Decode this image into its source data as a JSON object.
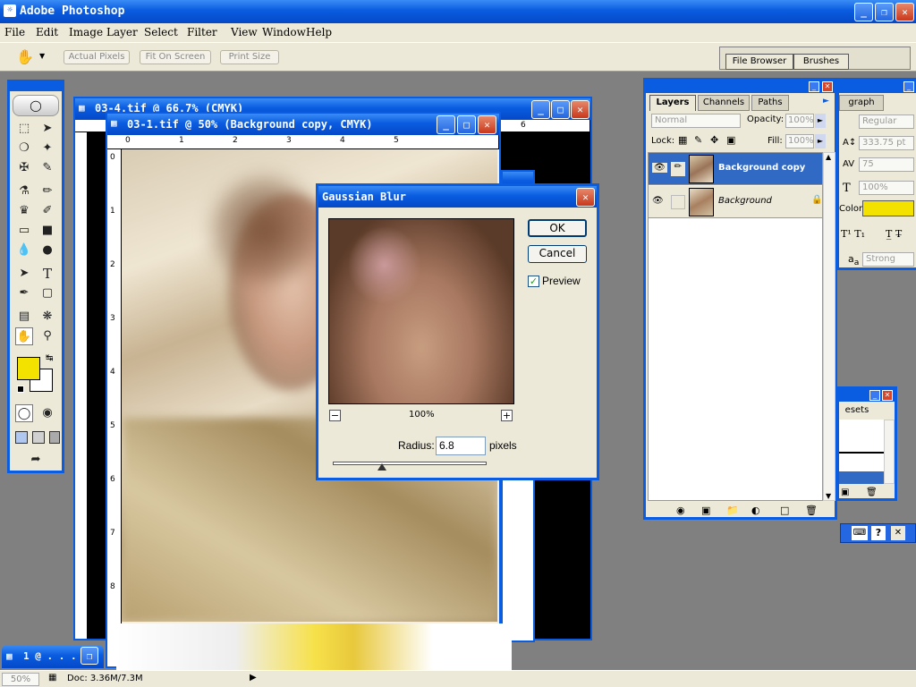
{
  "app": {
    "title": "Adobe Photoshop"
  },
  "menu": [
    "File",
    "Edit",
    "Image",
    "Layer",
    "Select",
    "Filter",
    "View",
    "Window",
    "Help"
  ],
  "options": {
    "actual_pixels": "Actual Pixels",
    "fit_on_screen": "Fit On Screen",
    "print_size": "Print Size"
  },
  "palette_well": {
    "file_browser": "File Browser",
    "brushes": "Brushes"
  },
  "back_doc": {
    "title": "03-4.tif @ 66.7% (CMYK)"
  },
  "doc": {
    "title": "03-1.tif @ 50% (Background copy, CMYK)",
    "ruler_h": [
      "0",
      "1",
      "2",
      "3",
      "4",
      "5",
      "6"
    ],
    "ruler_v": [
      "0",
      "1",
      "2",
      "3",
      "4",
      "5",
      "6",
      "7",
      "8"
    ]
  },
  "dialog": {
    "title": "Gaussian Blur",
    "ok": "OK",
    "cancel": "Cancel",
    "preview": "Preview",
    "zoom": "100%",
    "radius_label": "Radius:",
    "radius_value": "6.8",
    "units": "pixels",
    "zoom_out": "−",
    "zoom_in": "+"
  },
  "layers": {
    "tabs": [
      "Layers",
      "Channels",
      "Paths"
    ],
    "blend_mode": "Normal",
    "opacity_label": "Opacity:",
    "opacity": "100%",
    "lock_label": "Lock:",
    "fill_label": "Fill:",
    "fill": "100%",
    "items": [
      {
        "name": "Background copy",
        "selected": true
      },
      {
        "name": "Background",
        "selected": false
      }
    ]
  },
  "character": {
    "tab": "graph",
    "style": "Regular",
    "size": "333.75 pt",
    "tracking": "75",
    "scale": "100%",
    "color_label": "Color:",
    "aa": "Strong",
    "swatch": "#f3e200"
  },
  "presets": {
    "tab": "esets"
  },
  "minimized": {
    "label": "1 @ . . ."
  },
  "status": {
    "zoom": "50%",
    "doc": "Doc: 3.36M/7.3M"
  },
  "colors": {
    "foreground": "#f3e200",
    "background": "#ffffff"
  }
}
